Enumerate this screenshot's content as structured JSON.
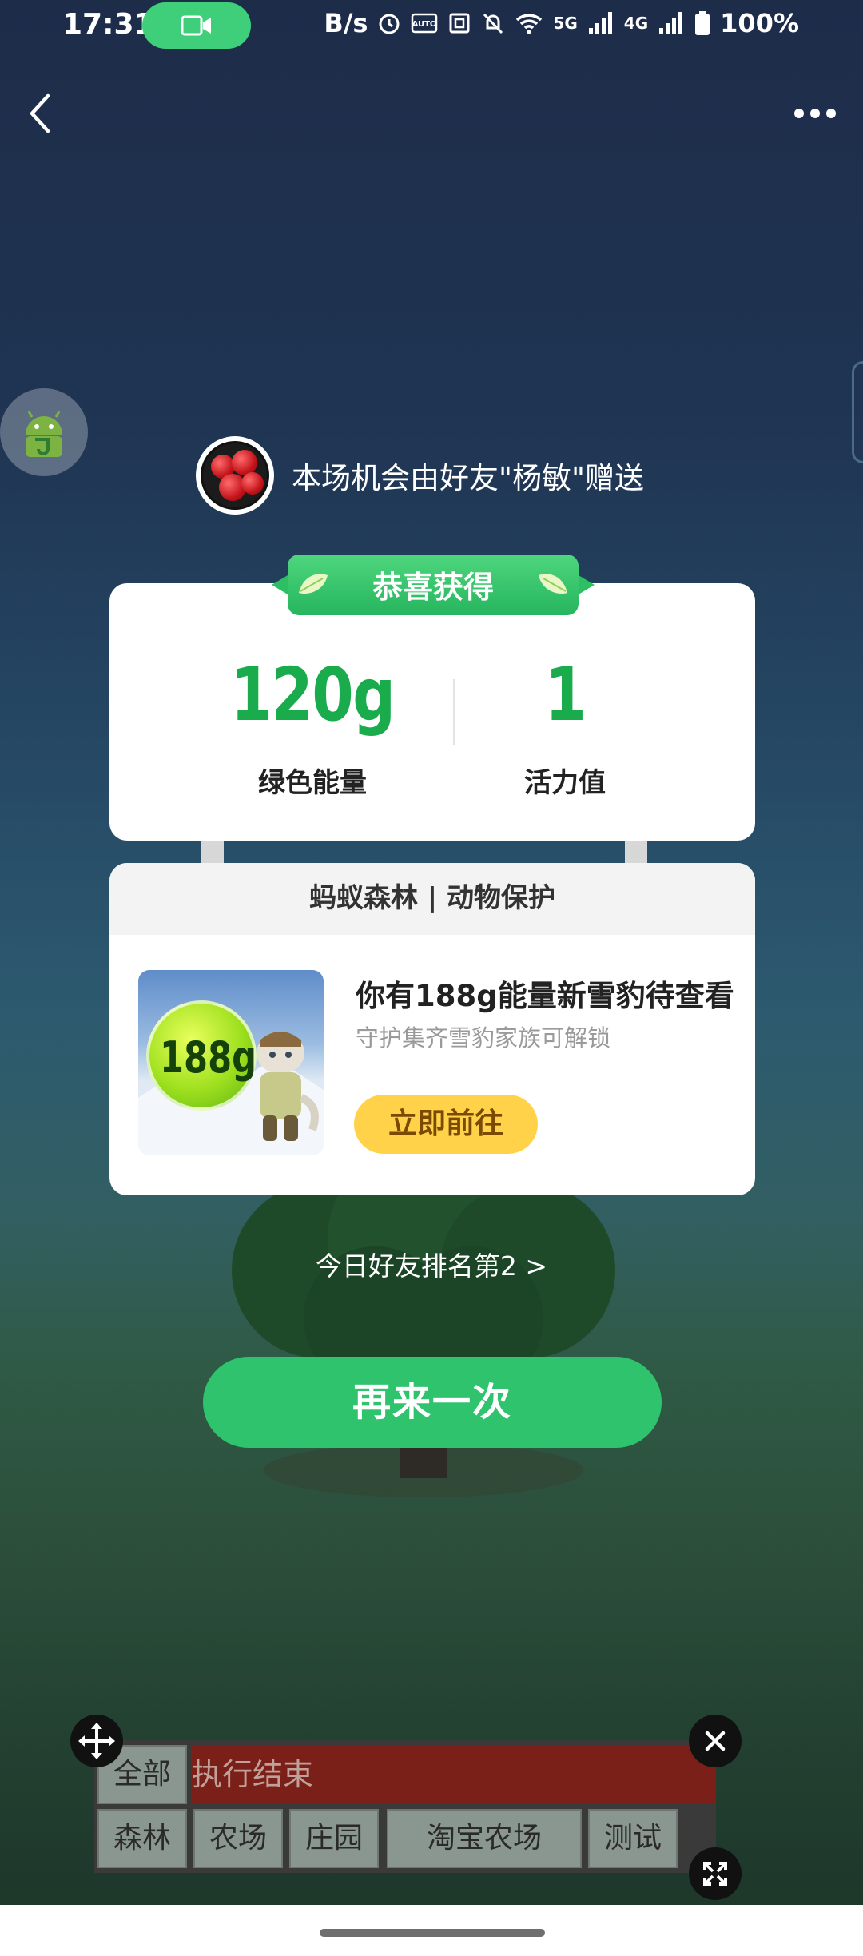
{
  "status_bar": {
    "time": "17:31",
    "net_speed": "B/s",
    "sim1": "5G",
    "sim2": "4G",
    "battery": "100%"
  },
  "gift": {
    "text": "本场机会由好友\"杨敏\"赠送"
  },
  "reward": {
    "ribbon": "恭喜获得",
    "energy_value": "120g",
    "energy_label": "绿色能量",
    "vitality_value": "1",
    "vitality_label": "活力值"
  },
  "forest": {
    "header": "蚂蚁森林 | 动物保护",
    "thumb_text": "188g",
    "title": "你有188g能量新雪豹待查看",
    "subtitle": "守护集齐雪豹家族可解锁",
    "button": "立即前往"
  },
  "ranking": "今日好友排名第2 >",
  "again_button": "再来一次",
  "panel": {
    "log": "执行结束",
    "tabs": [
      "全部",
      "森林",
      "农场",
      "庄园",
      "淘宝农场",
      "测试"
    ]
  },
  "colors": {
    "accent_green": "#2fc36e",
    "value_green": "#1aab4d",
    "button_yellow": "#ffd24a",
    "log_red": "#7a2018"
  }
}
